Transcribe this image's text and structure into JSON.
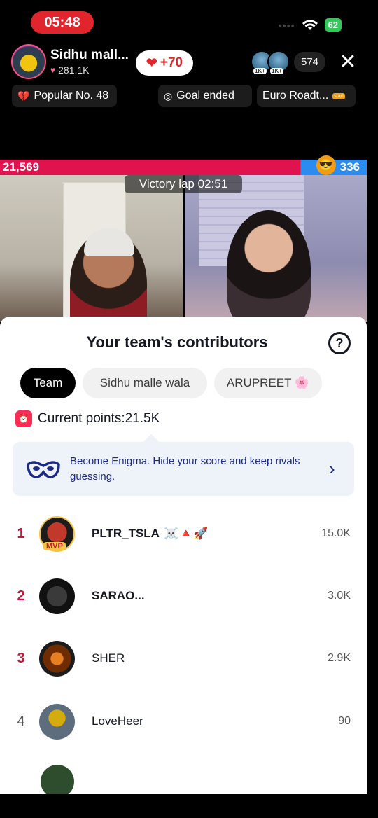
{
  "status": {
    "time": "05:48",
    "battery": "62"
  },
  "host": {
    "name": "Sidhu mall...",
    "likes": "281.1K",
    "like_gain": "+70"
  },
  "viewers": {
    "badge1": "1K+",
    "badge2": "1K+",
    "count": "574"
  },
  "chips": {
    "popular": "Popular No. 48",
    "goal": "Goal ended",
    "road": "Euro Roadt...",
    "road_sign": "start"
  },
  "battle": {
    "left_score": "21,569",
    "right_score": "336",
    "victory": "Victory lap 02:51"
  },
  "sheet": {
    "title": "Your team's contributors",
    "help": "?",
    "tabs": [
      "Team",
      "Sidhu malle wala",
      "ARUPREET 🌸"
    ],
    "points_label": "Current points:21.5K",
    "enigma_text": "Become Enigma. Hide your score and keep rivals guessing.",
    "mvp": "MVP",
    "rows": [
      {
        "rank": "1",
        "name": "PLTR_TSLA",
        "emoji": "☠️🔺🚀",
        "score": "15.0K"
      },
      {
        "rank": "2",
        "name": "SARAO...",
        "score": "3.0K"
      },
      {
        "rank": "3",
        "name": "SHER",
        "score": "2.9K"
      },
      {
        "rank": "4",
        "name": "LoveHeer",
        "score": "90"
      }
    ]
  },
  "colors": {
    "accent": "#fe2c55",
    "rank_red": "#c0183b",
    "enigma_blue": "#1b2a8a"
  }
}
